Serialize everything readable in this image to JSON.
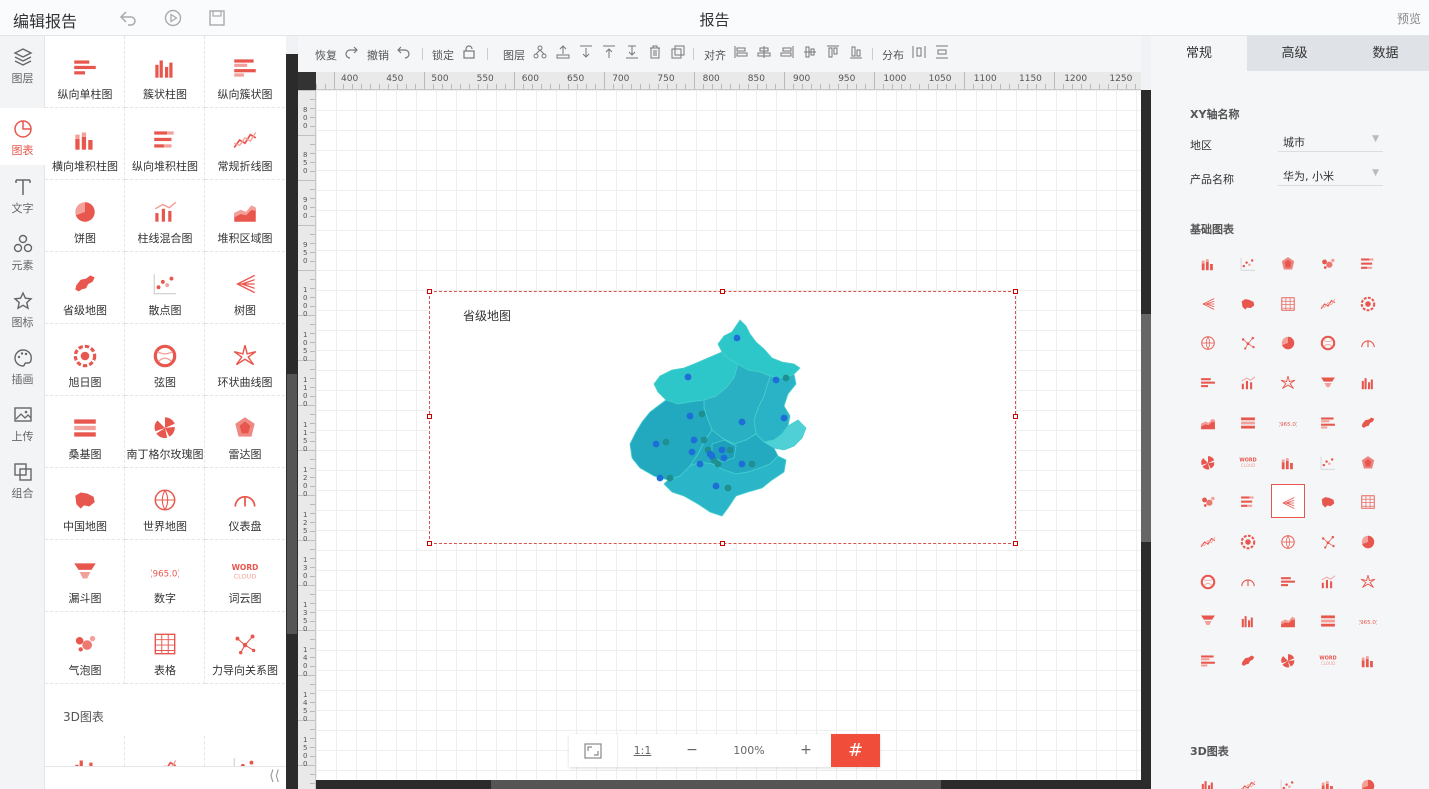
{
  "topbar": {
    "app_title": "编辑报告",
    "doc_title": "报告",
    "preview_label": "预览",
    "icons": [
      "undo-icon",
      "play-icon",
      "save-icon"
    ]
  },
  "iconbar": {
    "items": [
      {
        "label": "图层",
        "icon": "layers-icon"
      },
      {
        "label": "图表",
        "icon": "chart-pie-icon",
        "active": true
      },
      {
        "label": "文字",
        "icon": "text-icon"
      },
      {
        "label": "元素",
        "icon": "elements-icon"
      },
      {
        "label": "图标",
        "icon": "star-icon"
      },
      {
        "label": "插画",
        "icon": "palette-icon"
      },
      {
        "label": "上传",
        "icon": "upload-image-icon"
      },
      {
        "label": "组合",
        "icon": "group-icon"
      }
    ]
  },
  "components": {
    "items": [
      {
        "label": "纵向单柱图",
        "icon": "hbar-icon"
      },
      {
        "label": "簇状柱图",
        "icon": "cluster-bar-icon"
      },
      {
        "label": "纵向簇状图",
        "icon": "hcluster-icon"
      },
      {
        "label": "横向堆积柱图",
        "icon": "stack-bar-icon"
      },
      {
        "label": "纵向堆积柱图",
        "icon": "hstack-icon"
      },
      {
        "label": "常规折线图",
        "icon": "line-icon"
      },
      {
        "label": "饼图",
        "icon": "pie-icon"
      },
      {
        "label": "柱线混合图",
        "icon": "bar-line-icon"
      },
      {
        "label": "堆积区域图",
        "icon": "area-icon"
      },
      {
        "label": "省级地图",
        "icon": "province-map-icon"
      },
      {
        "label": "散点图",
        "icon": "scatter-icon"
      },
      {
        "label": "树图",
        "icon": "tree-icon"
      },
      {
        "label": "旭日图",
        "icon": "sunburst-icon"
      },
      {
        "label": "弦图",
        "icon": "chord-icon"
      },
      {
        "label": "环状曲线图",
        "icon": "radial-line-icon"
      },
      {
        "label": "桑基图",
        "icon": "sankey-icon"
      },
      {
        "label": "南丁格尔玫瑰图",
        "icon": "rose-icon"
      },
      {
        "label": "雷达图",
        "icon": "radar-icon"
      },
      {
        "label": "中国地图",
        "icon": "china-map-icon"
      },
      {
        "label": "世界地图",
        "icon": "world-map-icon"
      },
      {
        "label": "仪表盘",
        "icon": "gauge-icon"
      },
      {
        "label": "漏斗图",
        "icon": "funnel-icon"
      },
      {
        "label": "数字",
        "icon": "number-icon"
      },
      {
        "label": "词云图",
        "icon": "word-cloud-icon"
      },
      {
        "label": "气泡图",
        "icon": "bubble-icon"
      },
      {
        "label": "表格",
        "icon": "table-icon"
      },
      {
        "label": "力导向关系图",
        "icon": "force-graph-icon"
      }
    ],
    "section_3d": "3D图表",
    "collapse_icon": "double-chevron-left-icon"
  },
  "toolbar": {
    "redo": "恢复",
    "undo": "撤销",
    "lock": "锁定",
    "layer": "图层",
    "align": "对齐",
    "distribute": "分布"
  },
  "ruler": {
    "h_marks": [
      "400",
      "450",
      "500",
      "550",
      "600",
      "650",
      "700",
      "750",
      "800",
      "850",
      "900",
      "950",
      "1000",
      "1050",
      "1100",
      "1150",
      "1200",
      "1250"
    ],
    "v_marks": [
      "800",
      "850",
      "900",
      "950",
      "1000",
      "1050",
      "1100",
      "1150",
      "1200",
      "1250",
      "1300",
      "1350",
      "1400",
      "1450",
      "1500"
    ]
  },
  "widget": {
    "title": "省级地图",
    "map_color": "#2ec7c9"
  },
  "zoom": {
    "fit_icon": "fit-screen-icon",
    "one_to_one": "1:1",
    "minus": "−",
    "value": "100%",
    "plus": "+",
    "grid_icon": "grid-icon"
  },
  "right_panel": {
    "tabs": [
      "常规",
      "高级",
      "数据"
    ],
    "active_tab": "常规",
    "xy_section": "XY轴名称",
    "fields": [
      {
        "label": "地区",
        "value": "城市"
      },
      {
        "label": "产品名称",
        "value": "华为, 小米"
      }
    ],
    "basic_section": "基础图表",
    "section_3d": "3D图表",
    "selected_index": 32,
    "accent": "#e8574e"
  }
}
